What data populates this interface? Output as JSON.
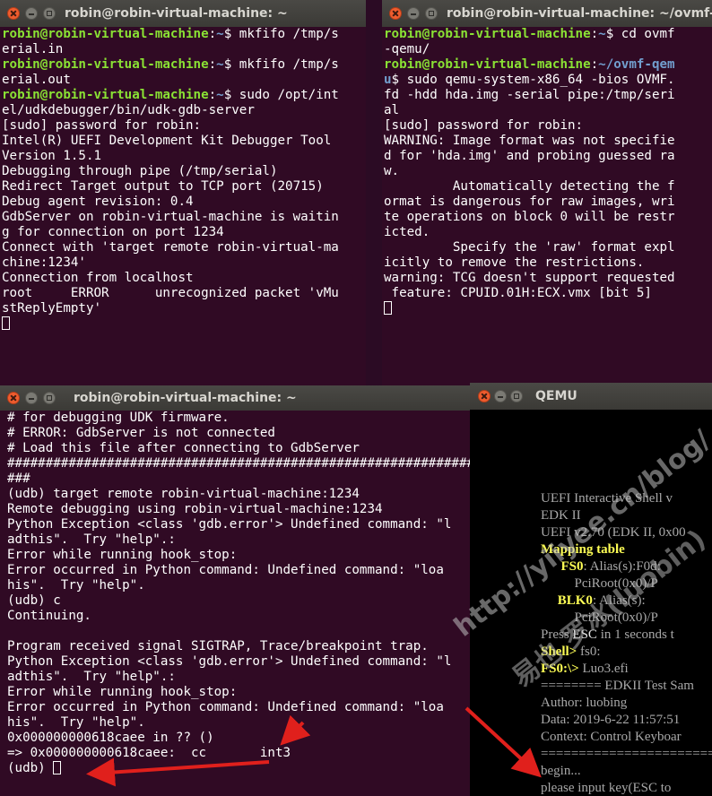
{
  "terminals": [
    {
      "title": "robin@robin-virtual-machine: ~",
      "lines": [
        [
          {
            "t": "robin@robin-virtual-machine",
            "c": "g"
          },
          {
            "t": ":"
          },
          {
            "t": "~",
            "c": "b"
          },
          {
            "t": "$ mkfifo /tmp/s"
          }
        ],
        [
          {
            "t": "erial.in"
          }
        ],
        [
          {
            "t": "robin@robin-virtual-machine",
            "c": "g"
          },
          {
            "t": ":"
          },
          {
            "t": "~",
            "c": "b"
          },
          {
            "t": "$ mkfifo /tmp/s"
          }
        ],
        [
          {
            "t": "erial.out"
          }
        ],
        [
          {
            "t": "robin@robin-virtual-machine",
            "c": "g"
          },
          {
            "t": ":"
          },
          {
            "t": "~",
            "c": "b"
          },
          {
            "t": "$ sudo /opt/int"
          }
        ],
        [
          {
            "t": "el/udkdebugger/bin/udk-gdb-server"
          }
        ],
        [
          {
            "t": "[sudo] password for robin:"
          }
        ],
        [
          {
            "t": "Intel(R) UEFI Development Kit Debugger Tool"
          }
        ],
        [
          {
            "t": "Version 1.5.1"
          }
        ],
        [
          {
            "t": "Debugging through pipe (/tmp/serial)"
          }
        ],
        [
          {
            "t": "Redirect Target output to TCP port (20715)"
          }
        ],
        [
          {
            "t": "Debug agent revision: 0.4"
          }
        ],
        [
          {
            "t": "GdbServer on robin-virtual-machine is waitin"
          }
        ],
        [
          {
            "t": "g for connection on port 1234"
          }
        ],
        [
          {
            "t": "Connect with 'target remote robin-virtual-ma"
          }
        ],
        [
          {
            "t": "chine:1234'"
          }
        ],
        [
          {
            "t": "Connection from localhost"
          }
        ],
        [
          {
            "t": "root     ERROR      unrecognized packet 'vMu"
          }
        ],
        [
          {
            "t": "stReplyEmpty'"
          }
        ],
        [
          {
            "t": "",
            "cursor": true
          }
        ]
      ]
    },
    {
      "title": "robin@robin-virtual-machine: ~/ovmf-",
      "lines": [
        [
          {
            "t": "robin@robin-virtual-machine",
            "c": "g"
          },
          {
            "t": ":"
          },
          {
            "t": "~",
            "c": "b"
          },
          {
            "t": "$ cd ovmf"
          }
        ],
        [
          {
            "t": "-qemu/"
          }
        ],
        [
          {
            "t": "robin@robin-virtual-machine",
            "c": "g"
          },
          {
            "t": ":"
          },
          {
            "t": "~/ovmf-qem",
            "c": "b"
          }
        ],
        [
          {
            "t": "u",
            "c": "b"
          },
          {
            "t": "$ sudo qemu-system-x86_64 -bios OVMF."
          }
        ],
        [
          {
            "t": "fd -hdd hda.img -serial pipe:/tmp/seri"
          }
        ],
        [
          {
            "t": "al"
          }
        ],
        [
          {
            "t": "[sudo] password for robin:"
          }
        ],
        [
          {
            "t": "WARNING: Image format was not specifie"
          }
        ],
        [
          {
            "t": "d for 'hda.img' and probing guessed ra"
          }
        ],
        [
          {
            "t": "w."
          }
        ],
        [
          {
            "t": "         Automatically detecting the f"
          }
        ],
        [
          {
            "t": "ormat is dangerous for raw images, wri"
          }
        ],
        [
          {
            "t": "te operations on block 0 will be restr"
          }
        ],
        [
          {
            "t": "icted."
          }
        ],
        [
          {
            "t": "         Specify the 'raw' format expl"
          }
        ],
        [
          {
            "t": "icitly to remove the restrictions."
          }
        ],
        [
          {
            "t": "warning: TCG doesn't support requested"
          }
        ],
        [
          {
            "t": " feature: CPUID.01H:ECX.vmx [bit 5]"
          }
        ],
        [
          {
            "t": "",
            "cursor": true
          }
        ]
      ]
    },
    {
      "title": "robin@robin-virtual-machine: ~",
      "lines": [
        [
          {
            "t": "# for debugging UDK firmware."
          }
        ],
        [
          {
            "t": "# ERROR: GdbServer is not connected"
          }
        ],
        [
          {
            "t": "# Load this file after connecting to GdbServer"
          }
        ],
        [
          {
            "t": "##############################################################"
          }
        ],
        [
          {
            "t": "###"
          }
        ],
        [
          {
            "t": "(udb) target remote robin-virtual-machine:1234"
          }
        ],
        [
          {
            "t": "Remote debugging using robin-virtual-machine:1234"
          }
        ],
        [
          {
            "t": "Python Exception <class 'gdb.error'> Undefined command: \"l"
          }
        ],
        [
          {
            "t": "adthis\".  Try \"help\".:"
          }
        ],
        [
          {
            "t": "Error while running hook_stop:"
          }
        ],
        [
          {
            "t": "Error occurred in Python command: Undefined command: \"loa"
          }
        ],
        [
          {
            "t": "his\".  Try \"help\"."
          }
        ],
        [
          {
            "t": "(udb) c"
          }
        ],
        [
          {
            "t": "Continuing."
          }
        ],
        [
          {
            "t": ""
          }
        ],
        [
          {
            "t": "Program received signal SIGTRAP, Trace/breakpoint trap."
          }
        ],
        [
          {
            "t": "Python Exception <class 'gdb.error'> Undefined command: \"l"
          }
        ],
        [
          {
            "t": "adthis\".  Try \"help\".:"
          }
        ],
        [
          {
            "t": "Error while running hook_stop:"
          }
        ],
        [
          {
            "t": "Error occurred in Python command: Undefined command: \"loa"
          }
        ],
        [
          {
            "t": "his\".  Try \"help\"."
          }
        ],
        [
          {
            "t": "0x000000000618caee in ?? ()"
          }
        ],
        [
          {
            "t": "=> 0x000000000618caee:  cc       int3"
          }
        ],
        [
          {
            "t": "(udb) ",
            "cursor": true
          }
        ]
      ]
    }
  ],
  "qemu": {
    "title": "QEMU",
    "lines": [
      [
        {
          "t": "UEFI Interactive Shell v"
        }
      ],
      [
        {
          "t": "EDK II"
        }
      ],
      [
        {
          "t": "UEFI v2.70 (EDK II, 0x00"
        }
      ],
      [
        {
          "t": "Mapping table",
          "c": "y"
        }
      ],
      [
        {
          "t": "      "
        },
        {
          "t": "FS0",
          "c": "y"
        },
        {
          "t": ": Alias(s):F0d:"
        }
      ],
      [
        {
          "t": "          PciRoot(0x0)/P"
        }
      ],
      [
        {
          "t": "     "
        },
        {
          "t": "BLK0",
          "c": "y"
        },
        {
          "t": ": Alias(s):"
        }
      ],
      [
        {
          "t": "          PciRoot(0x0)/P"
        }
      ],
      [
        {
          "t": "Press "
        },
        {
          "t": "ESC",
          "c": "w"
        },
        {
          "t": " in 1 seconds t"
        }
      ],
      [
        {
          "t": "Shell> ",
          "c": "y"
        },
        {
          "t": "fs0:"
        }
      ],
      [
        {
          "t": "FS0:\\> ",
          "c": "y"
        },
        {
          "t": "Luo3.efi"
        }
      ],
      [
        {
          "t": "======== EDKII Test Sam"
        }
      ],
      [
        {
          "t": "Author: luobing"
        }
      ],
      [
        {
          "t": "Data: 2019-6-22 11:57:51"
        }
      ],
      [
        {
          "t": "Context: Control Keyboar"
        }
      ],
      [
        {
          "t": "=========================="
        }
      ],
      [
        {
          "t": "begin..."
        }
      ],
      [
        {
          "t": "please input key(ESC to "
        }
      ],
      [
        {
          "t": ""
        }
      ],
      [
        {
          "t": "_",
          "c": "w"
        }
      ]
    ],
    "watermark": [
      "http://yiiyee.cn/blog/",
      "易也 罗冰(luobin)"
    ]
  },
  "colors": {
    "terminal_bg": "#300a24",
    "prompt_user": "#8ae234",
    "prompt_path": "#729fcf",
    "annotation_arrow": "#e0201c",
    "qemu_highlight": "#ffff55"
  }
}
